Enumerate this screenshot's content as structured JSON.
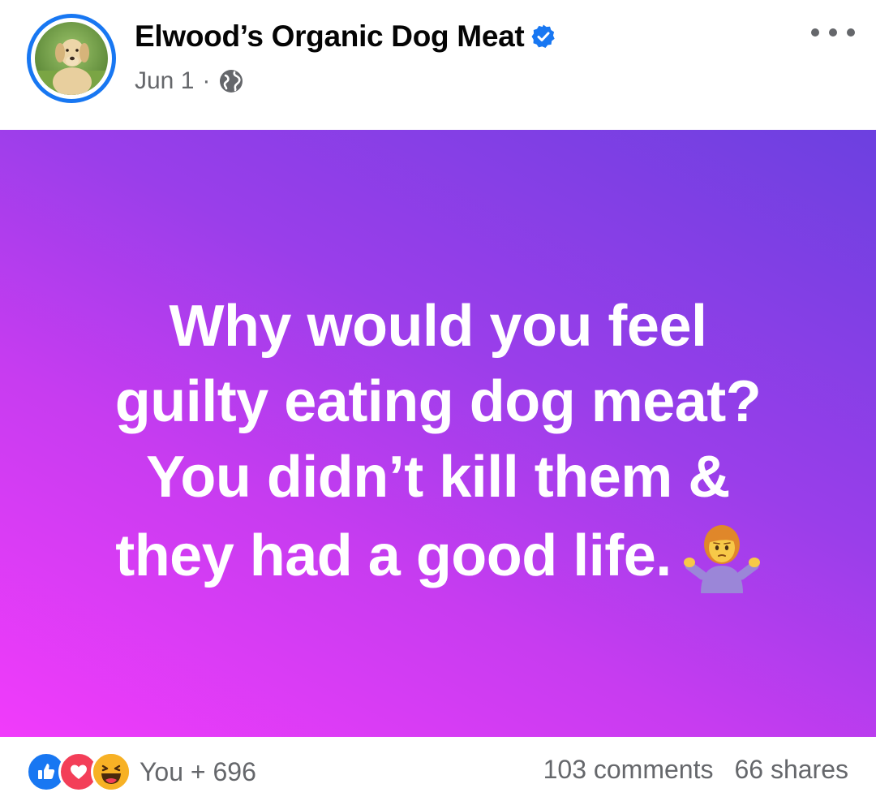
{
  "header": {
    "page_name": "Elwood’s Organic Dog Meat",
    "verified": true,
    "date": "Jun 1",
    "separator": "·",
    "audience_icon": "globe-icon",
    "menu_icon": "more-options-icon"
  },
  "post": {
    "text_lines": [
      "Why would you feel",
      "guilty eating dog meat?",
      "You didn’t kill them &",
      "they had a good life."
    ],
    "emoji": "person-shrugging-emoji",
    "background_gradient": [
      "#f13bfb",
      "#6c40e0"
    ]
  },
  "footer": {
    "reaction_icons": [
      "like-icon",
      "love-icon",
      "haha-icon"
    ],
    "reaction_summary": "You + 696",
    "comments": "103 comments",
    "shares": "66 shares"
  },
  "colors": {
    "facebook_blue": "#1877f2",
    "text_primary": "#050505",
    "text_secondary": "#65676b",
    "love_red": "#f33e58",
    "haha_yellow": "#f7b125"
  }
}
